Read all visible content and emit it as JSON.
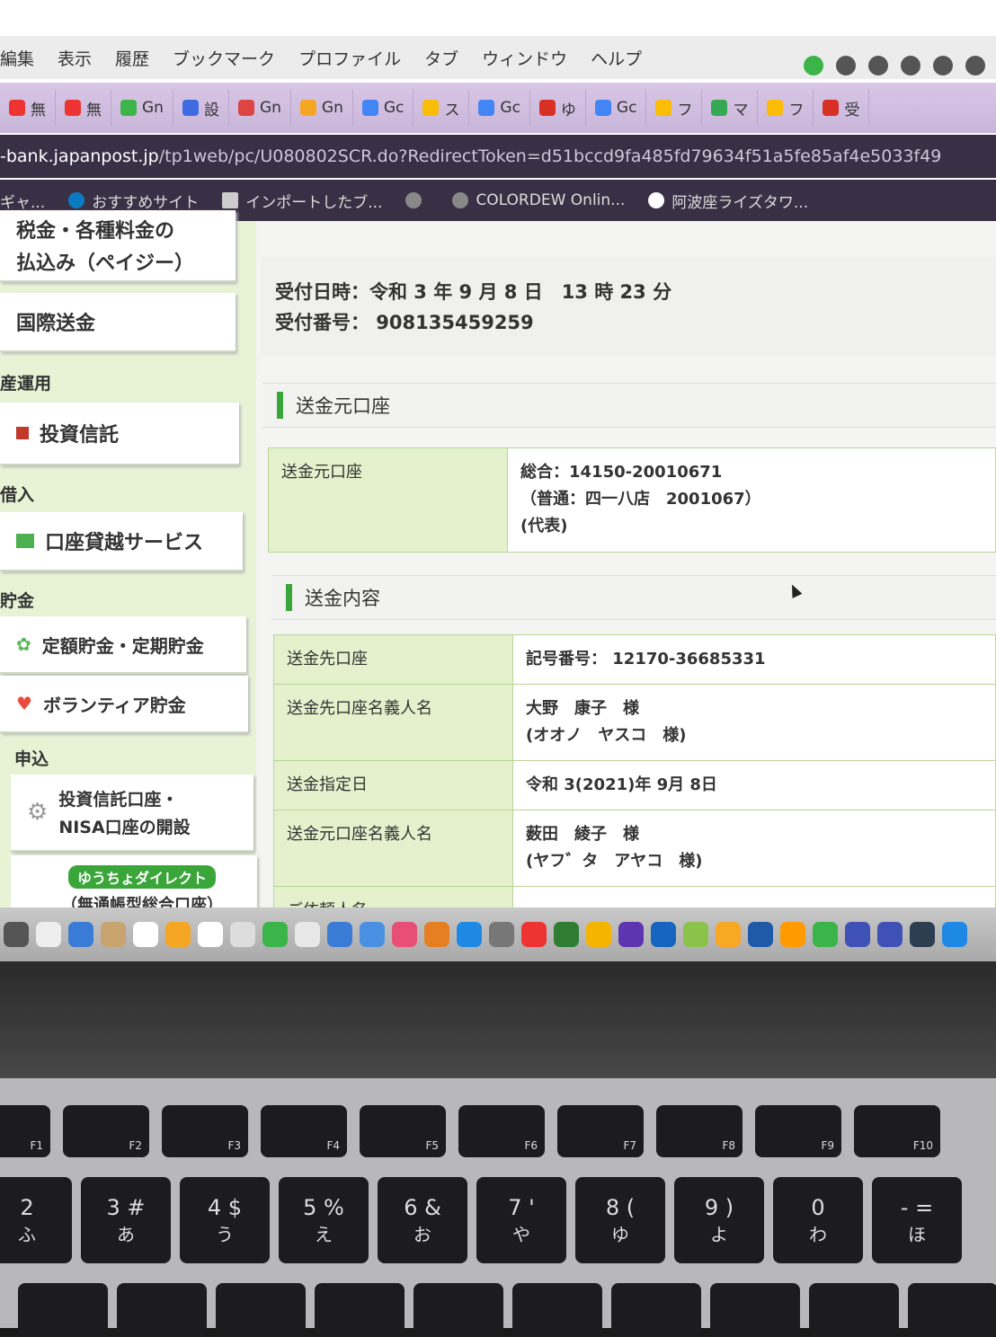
{
  "menubar": {
    "items": [
      "編集",
      "表示",
      "履歴",
      "ブックマーク",
      "プロファイル",
      "タブ",
      "ウィンドウ",
      "ヘルプ"
    ]
  },
  "tabs": [
    {
      "label": "無",
      "color": "#e33"
    },
    {
      "label": "無",
      "color": "#e33"
    },
    {
      "label": "Gn",
      "color": "#3bb54a"
    },
    {
      "label": "設",
      "color": "#3c6ce0"
    },
    {
      "label": "Gn",
      "color": "#d44"
    },
    {
      "label": "Gn",
      "color": "#f5a623"
    },
    {
      "label": "Gc",
      "color": "#4285f4"
    },
    {
      "label": "ス",
      "color": "#fbbc05"
    },
    {
      "label": "Gc",
      "color": "#4285f4"
    },
    {
      "label": "ゆ",
      "color": "#d93025"
    },
    {
      "label": "Gc",
      "color": "#4285f4"
    },
    {
      "label": "フ",
      "color": "#fbbc05"
    },
    {
      "label": "マ",
      "color": "#34a853"
    },
    {
      "label": "フ",
      "color": "#fbbc05"
    },
    {
      "label": "受",
      "color": "#d93025"
    }
  ],
  "url": {
    "host": "-bank.japanpost.jp",
    "path": "/tp1web/pc/U080802SCR.do?RedirectToken=d51bccd9fa485fd79634f51a5fe85af4e5033f49"
  },
  "bookmarks": [
    "ギャ...",
    "おすすめサイト",
    "インポートしたブ...",
    "",
    "COLORDEW Onlin...",
    "阿波座ライズタワ..."
  ],
  "sidebar": {
    "tax_label_1": "税金・各種料金の",
    "tax_label_2": "払込み（ペイジー）",
    "intl": "国際送金",
    "head_asset": "産運用",
    "invest": "投資信託",
    "head_loan": "借入",
    "overdraft": "口座貸越サービス",
    "head_savings": "貯金",
    "fixed": "定額貯金・定期貯金",
    "volunteer": "ボランティア貯金",
    "head_apply": "申込",
    "nisa_1": "投資信託口座・",
    "nisa_2": "NISA口座の開設",
    "direct_badge": "ゆうちょダイレクト",
    "direct_sub": "（無通帳型総合口座）"
  },
  "receipt": {
    "datetime": "受付日時：令和 3 年 9 月 8 日　13 時 23 分",
    "number": "受付番号：  908135459259"
  },
  "source_section": {
    "title": "送金元口座",
    "label": "送金元口座",
    "line1": "総合：14150-20010671",
    "line2": "（普通：四一八店　2001067）",
    "line3": "(代表)"
  },
  "detail_section": {
    "title": "送金内容",
    "rows": [
      {
        "label": "送金先口座",
        "line1": "記号番号：  12170-36685331",
        "line2": ""
      },
      {
        "label": "送金先口座名義人名",
        "line1": "大野　康子　様",
        "line2": "(オオノ　ヤスコ　様)"
      },
      {
        "label": "送金指定日",
        "line1": "令和 3(2021)年 9月 8日",
        "line2": ""
      },
      {
        "label": "送金元口座名義人名",
        "line1": "薮田　綾子　様",
        "line2": "(ヤフ゛タ　アヤコ　様)"
      },
      {
        "label": "ご依頼人名",
        "line1": "",
        "line2": ""
      }
    ]
  },
  "keyboard": {
    "fn_row": [
      "F1",
      "F2",
      "F3",
      "F4",
      "F5",
      "F6",
      "F7",
      "F8",
      "F9",
      "F10"
    ],
    "num_row": [
      {
        "main": "2",
        "kana": "ふ"
      },
      {
        "main": "3 #",
        "kana": "あ"
      },
      {
        "main": "4 $",
        "kana": "う"
      },
      {
        "main": "5 %",
        "kana": "え"
      },
      {
        "main": "6 &",
        "kana": "お"
      },
      {
        "main": "7 '",
        "kana": "や"
      },
      {
        "main": "8 (",
        "kana": "ゆ"
      },
      {
        "main": "9 )",
        "kana": "よ"
      },
      {
        "main": "0",
        "kana": "わ"
      },
      {
        "main": "- =",
        "kana": "ほ"
      }
    ]
  },
  "colors": {
    "accent_green": "#3aa63a",
    "label_bg": "#e4f1cc"
  }
}
